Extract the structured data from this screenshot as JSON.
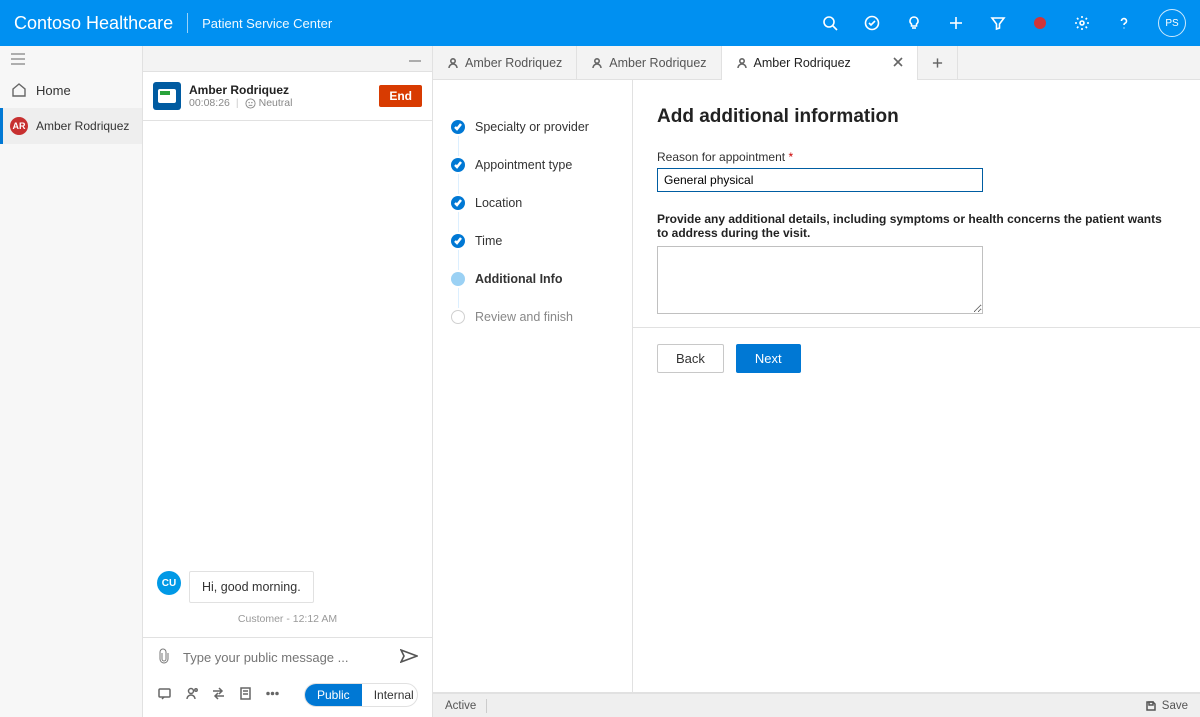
{
  "topbar": {
    "brand": "Contoso Healthcare",
    "subtitle": "Patient Service Center",
    "avatar_initials": "PS"
  },
  "nav": {
    "home_label": "Home",
    "session": {
      "initials": "AR",
      "name": "Amber Rodriquez"
    }
  },
  "conversation": {
    "header": {
      "name": "Amber Rodriquez",
      "timer": "00:08:26",
      "sentiment": "Neutral",
      "end_label": "End"
    },
    "message": {
      "avatar": "CU",
      "text": "Hi, good morning."
    },
    "meta": "Customer - 12:12 AM",
    "compose_placeholder": "Type your public message ...",
    "segment_public": "Public",
    "segment_internal": "Internal"
  },
  "tabs": {
    "t1": "Amber Rodriquez",
    "t2": "Amber Rodriquez",
    "t3": "Amber Rodriquez"
  },
  "stepper": {
    "s1": "Specialty or provider",
    "s2": "Appointment type",
    "s3": "Location",
    "s4": "Time",
    "s5": "Additional Info",
    "s6": "Review and finish"
  },
  "form": {
    "title": "Add additional information",
    "reason_label": "Reason for appointment",
    "reason_value": "General physical",
    "details_label": "Provide any additional details, including symptoms or health concerns the patient wants to address during the visit.",
    "back": "Back",
    "next": "Next"
  },
  "status": {
    "state": "Active",
    "save": "Save"
  }
}
